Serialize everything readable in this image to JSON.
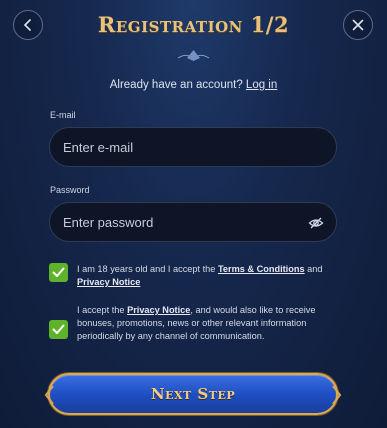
{
  "header": {
    "title": "Registration 1/2"
  },
  "account": {
    "prompt": "Already have an account?",
    "login_link": "Log in"
  },
  "form": {
    "email_label": "E-mail",
    "email_placeholder": "Enter e-mail",
    "email_value": "",
    "password_label": "Password",
    "password_placeholder": "Enter password",
    "password_value": ""
  },
  "consents": {
    "age": {
      "checked": true,
      "text_before": "I am 18 years old and I accept the ",
      "terms_link": "Terms & Conditions",
      "text_and": " and ",
      "privacy_link": "Privacy Notice"
    },
    "marketing": {
      "checked": true,
      "text_before": "I accept the ",
      "privacy_link": "Privacy Notice",
      "text_after": ", and would also like to receive bonuses, promotions, news or other relevant information periodically by any channel of communication."
    }
  },
  "actions": {
    "next_label": "Next Step"
  },
  "icons": {
    "back": "chevron-left-icon",
    "close": "close-icon",
    "password_toggle": "eye-slash-icon",
    "check": "checkmark-icon"
  },
  "colors": {
    "accent_gold": "#e8c27a",
    "checkbox_green": "#5fb32b",
    "button_blue": "#1f4fc4",
    "background": "#16284e"
  }
}
